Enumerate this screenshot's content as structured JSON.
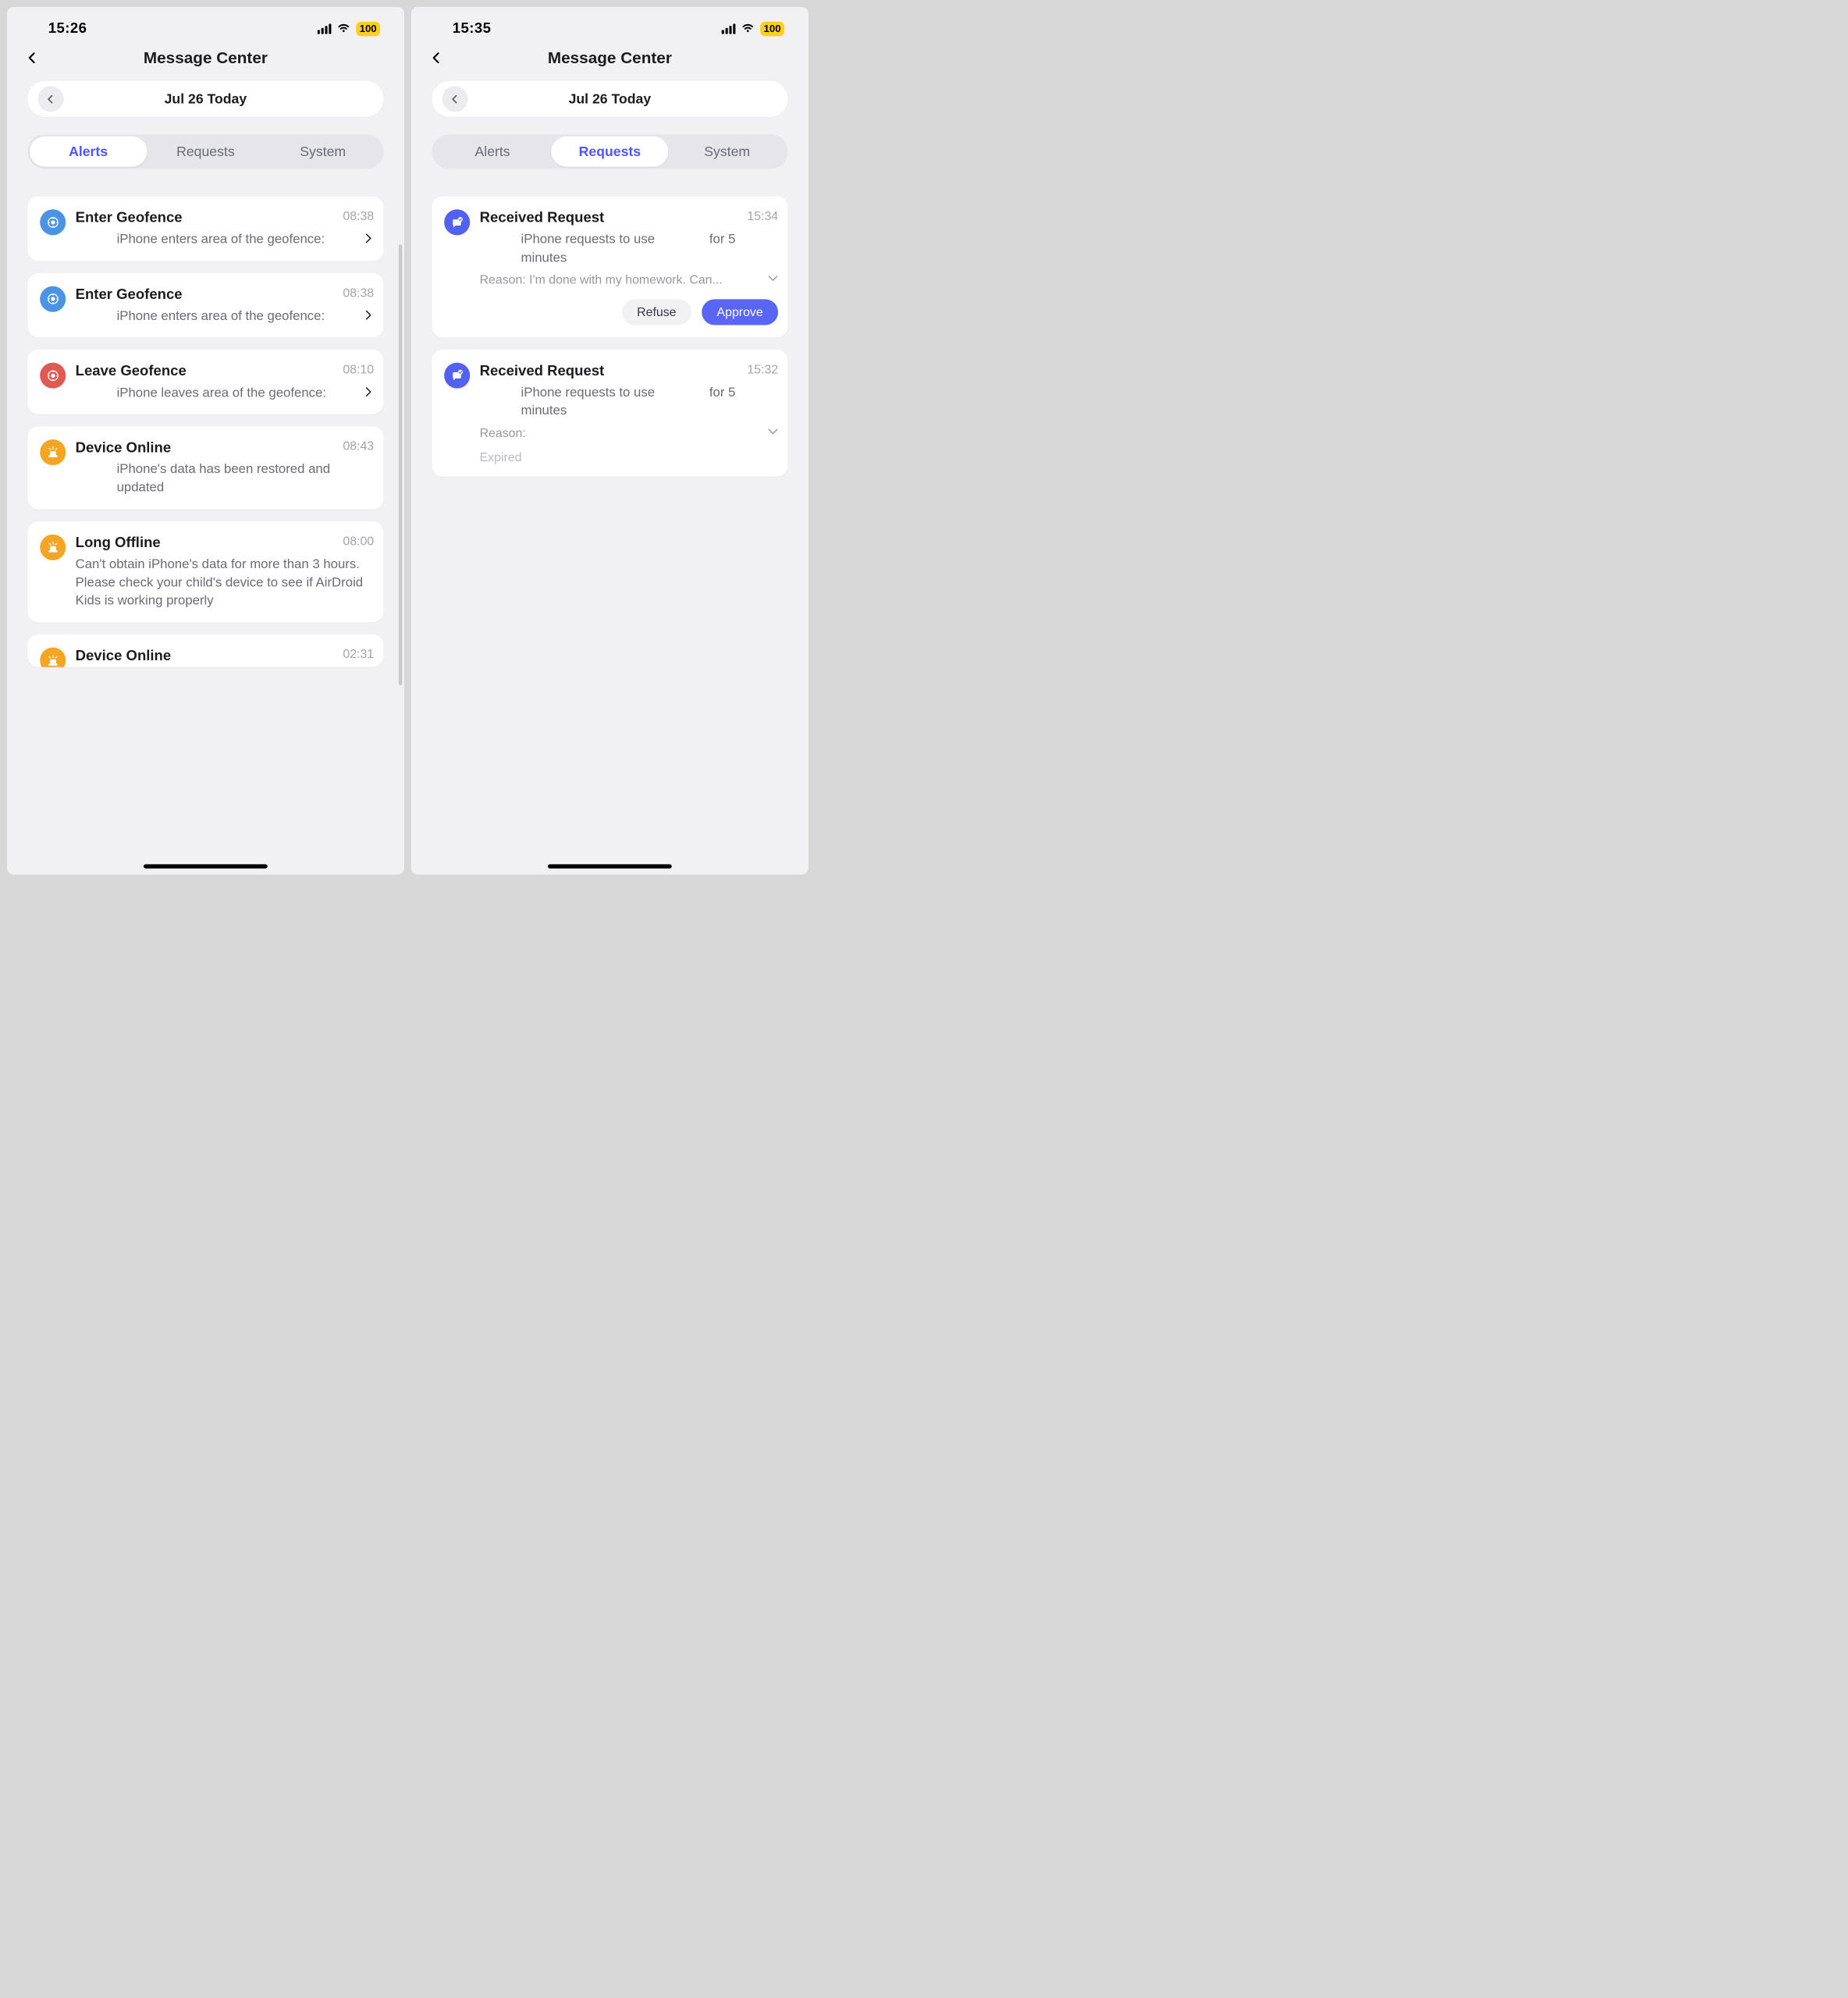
{
  "phone1": {
    "status": {
      "time": "15:26",
      "battery": "100"
    },
    "header": {
      "title": "Message Center"
    },
    "date": {
      "label": "Jul 26 Today"
    },
    "tabs": {
      "alerts": "Alerts",
      "requests": "Requests",
      "system": "System",
      "active": "alerts"
    },
    "alerts": [
      {
        "icon": "geofence-enter",
        "color": "blue",
        "title": "Enter Geofence",
        "time": "08:38",
        "body": "iPhone enters area of the geofence:",
        "chevron": true
      },
      {
        "icon": "geofence-enter",
        "color": "blue",
        "title": "Enter Geofence",
        "time": "08:38",
        "body": "iPhone enters area of the geofence:",
        "chevron": true
      },
      {
        "icon": "geofence-leave",
        "color": "red",
        "title": "Leave Geofence",
        "time": "08:10",
        "body": "iPhone leaves area of the geofence:",
        "chevron": true
      },
      {
        "icon": "device-status",
        "color": "orange",
        "title": "Device Online",
        "time": "08:43",
        "body": "iPhone's data has been restored and updated",
        "chevron": false
      },
      {
        "icon": "device-status",
        "color": "orange",
        "title": "Long Offline",
        "time": "08:00",
        "body": "Can't obtain           iPhone's data for more than 3 hours. Please check your child's device to see if AirDroid Kids is working properly",
        "chevron": false,
        "no_indent": true
      },
      {
        "icon": "device-status",
        "color": "orange",
        "title": "Device Online",
        "time": "02:31",
        "body": "",
        "chevron": false,
        "cutoff": true
      }
    ]
  },
  "phone2": {
    "status": {
      "time": "15:35",
      "battery": "100"
    },
    "header": {
      "title": "Message Center"
    },
    "date": {
      "label": "Jul 26 Today"
    },
    "tabs": {
      "alerts": "Alerts",
      "requests": "Requests",
      "system": "System",
      "active": "requests"
    },
    "requests": [
      {
        "title": "Received Request",
        "time": "15:34",
        "body": "iPhone requests to use               for 5 minutes",
        "reason": "Reason: I'm done with my homework. Can...",
        "actions": {
          "refuse": "Refuse",
          "approve": "Approve"
        }
      },
      {
        "title": "Received Request",
        "time": "15:32",
        "body": "iPhone requests to use               for 5 minutes",
        "reason": "Reason:",
        "expired": "Expired"
      }
    ]
  }
}
